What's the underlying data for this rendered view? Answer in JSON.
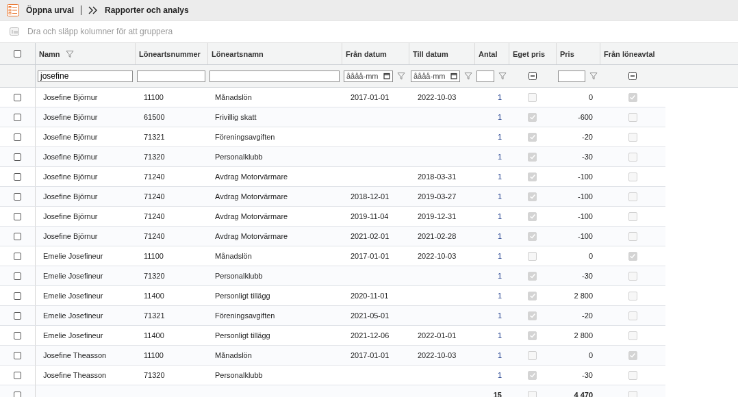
{
  "toolbar": {
    "open_selection": "Öppna urval",
    "breadcrumb": "Rapporter och analys"
  },
  "group_bar": {
    "placeholder": "Dra och släpp kolumner för att gruppera"
  },
  "table": {
    "select_all": {
      "checked": false
    },
    "columns": [
      {
        "label": "Namn",
        "filtered": true
      },
      {
        "label": "Löneartsnummer",
        "filtered": false
      },
      {
        "label": "Löneartsnamn",
        "filtered": false
      },
      {
        "label": "Från datum",
        "filtered": false
      },
      {
        "label": "Till datum",
        "filtered": false
      },
      {
        "label": "Antal",
        "filtered": false
      },
      {
        "label": "Eget pris",
        "filtered": false
      },
      {
        "label": "Pris",
        "filtered": false
      },
      {
        "label": "Från löneavtal",
        "filtered": false
      }
    ],
    "filters": [
      {
        "kind": "text",
        "value": "josefine",
        "funnel": false
      },
      {
        "kind": "text",
        "funnel": false
      },
      {
        "kind": "text",
        "funnel": false
      },
      {
        "kind": "date",
        "placeholder": "åååå-mm",
        "funnel": true
      },
      {
        "kind": "date",
        "placeholder": "åååå-mm",
        "funnel": true
      },
      {
        "kind": "number",
        "funnel": true
      },
      {
        "kind": "tristate",
        "funnel": false
      },
      {
        "kind": "number",
        "funnel": true
      },
      {
        "kind": "tristate",
        "funnel": false
      }
    ],
    "rows": [
      {
        "checked": false,
        "name": "Josefine Björnur",
        "code": "11100",
        "wage_type": "Månadslön",
        "from": "2017-01-01",
        "to": "2022-10-03",
        "quantity": "1",
        "own_price": false,
        "price": "0",
        "from_agreement": true
      },
      {
        "checked": false,
        "name": "Josefine Björnur",
        "code": "61500",
        "wage_type": "Frivillig skatt",
        "from": "",
        "to": "",
        "quantity": "1",
        "own_price": true,
        "price": "-600",
        "from_agreement": false
      },
      {
        "checked": false,
        "name": "Josefine Björnur",
        "code": "71321",
        "wage_type": "Föreningsavgiften",
        "from": "",
        "to": "",
        "quantity": "1",
        "own_price": true,
        "price": "-20",
        "from_agreement": false
      },
      {
        "checked": false,
        "name": "Josefine Björnur",
        "code": "71320",
        "wage_type": "Personalklubb",
        "from": "",
        "to": "",
        "quantity": "1",
        "own_price": true,
        "price": "-30",
        "from_agreement": false
      },
      {
        "checked": false,
        "name": "Josefine Björnur",
        "code": "71240",
        "wage_type": "Avdrag Motorvärmare",
        "from": "",
        "to": "2018-03-31",
        "quantity": "1",
        "own_price": true,
        "price": "-100",
        "from_agreement": false
      },
      {
        "checked": false,
        "name": "Josefine Björnur",
        "code": "71240",
        "wage_type": "Avdrag Motorvärmare",
        "from": "2018-12-01",
        "to": "2019-03-27",
        "quantity": "1",
        "own_price": true,
        "price": "-100",
        "from_agreement": false
      },
      {
        "checked": false,
        "name": "Josefine Björnur",
        "code": "71240",
        "wage_type": "Avdrag Motorvärmare",
        "from": "2019-11-04",
        "to": "2019-12-31",
        "quantity": "1",
        "own_price": true,
        "price": "-100",
        "from_agreement": false
      },
      {
        "checked": false,
        "name": "Josefine Björnur",
        "code": "71240",
        "wage_type": "Avdrag Motorvärmare",
        "from": "2021-02-01",
        "to": "2021-02-28",
        "quantity": "1",
        "own_price": true,
        "price": "-100",
        "from_agreement": false
      },
      {
        "checked": false,
        "name": "Emelie Josefineur",
        "code": "11100",
        "wage_type": "Månadslön",
        "from": "2017-01-01",
        "to": "2022-10-03",
        "quantity": "1",
        "own_price": false,
        "price": "0",
        "from_agreement": true
      },
      {
        "checked": false,
        "name": "Emelie Josefineur",
        "code": "71320",
        "wage_type": "Personalklubb",
        "from": "",
        "to": "",
        "quantity": "1",
        "own_price": true,
        "price": "-30",
        "from_agreement": false
      },
      {
        "checked": false,
        "name": "Emelie Josefineur",
        "code": "11400",
        "wage_type": "Personligt tillägg",
        "from": "2020-11-01",
        "to": "",
        "quantity": "1",
        "own_price": true,
        "price": "2 800",
        "from_agreement": false
      },
      {
        "checked": false,
        "name": "Emelie Josefineur",
        "code": "71321",
        "wage_type": "Föreningsavgiften",
        "from": "2021-05-01",
        "to": "",
        "quantity": "1",
        "own_price": true,
        "price": "-20",
        "from_agreement": false
      },
      {
        "checked": false,
        "name": "Emelie Josefineur",
        "code": "11400",
        "wage_type": "Personligt tillägg",
        "from": "2021-12-06",
        "to": "2022-01-01",
        "quantity": "1",
        "own_price": true,
        "price": "2 800",
        "from_agreement": false
      },
      {
        "checked": false,
        "name": "Josefine Theasson",
        "code": "11100",
        "wage_type": "Månadslön",
        "from": "2017-01-01",
        "to": "2022-10-03",
        "quantity": "1",
        "own_price": false,
        "price": "0",
        "from_agreement": true
      },
      {
        "checked": false,
        "name": "Josefine Theasson",
        "code": "71320",
        "wage_type": "Personalklubb",
        "from": "",
        "to": "",
        "quantity": "1",
        "own_price": true,
        "price": "-30",
        "from_agreement": false
      }
    ],
    "footer": {
      "checked": false,
      "quantity": "15",
      "own_price": false,
      "price": "4 470",
      "from_agreement": false
    }
  }
}
